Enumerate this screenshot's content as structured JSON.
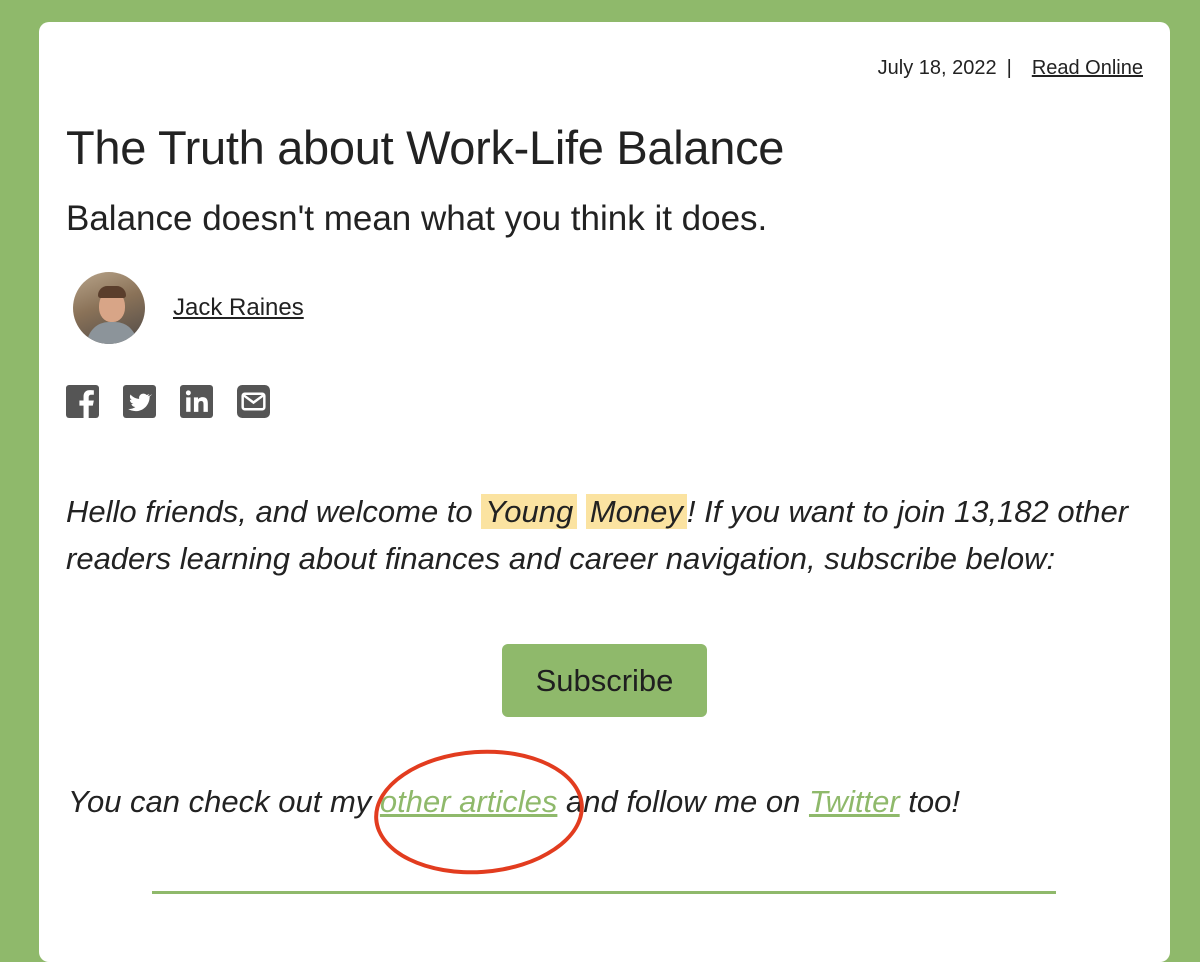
{
  "header": {
    "date": "July 18, 2022",
    "separator": "|",
    "read_online": "Read Online"
  },
  "article": {
    "title": "The Truth about Work-Life Balance",
    "subtitle": "Balance doesn't mean what you think it does.",
    "author": "Jack Raines"
  },
  "share": {
    "icons": [
      "facebook-icon",
      "twitter-icon",
      "linkedin-icon",
      "email-icon"
    ]
  },
  "intro": {
    "part1": "Hello friends, and welcome to ",
    "highlight1": "Young",
    "highlight2": "Money",
    "part2": "! If you want to join 13,182 other readers learning about finances and career navigation, subscribe below:"
  },
  "subscribe_label": "Subscribe",
  "follow": {
    "part1": "You can check out my ",
    "link1": "other articles",
    "part2": " and follow me on ",
    "link2": "Twitter",
    "part3": " too!"
  },
  "colors": {
    "background": "#8fb96b",
    "highlight": "#fbe3a1",
    "annotation": "#e23c1f"
  }
}
